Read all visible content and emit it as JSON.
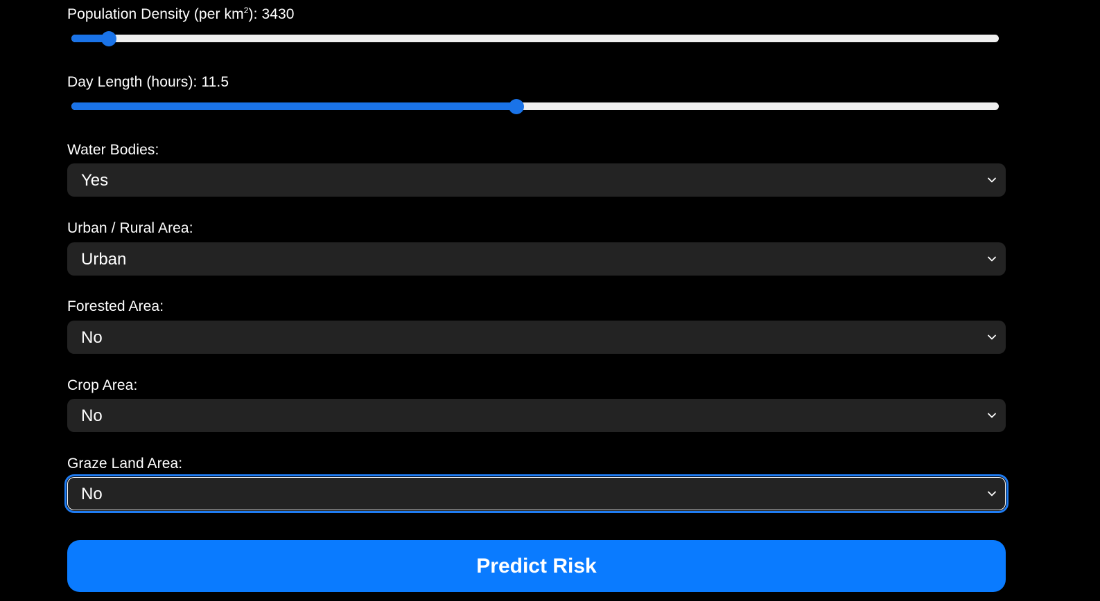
{
  "population_density": {
    "label": "Population Density (per km",
    "sup": "2",
    "label_suffix": "): ",
    "value": "3430",
    "fraction": 0.04
  },
  "day_length": {
    "label": "Day Length (hours): ",
    "value": "11.5",
    "fraction": 0.48
  },
  "water_bodies": {
    "label": "Water Bodies:",
    "value": "Yes"
  },
  "urban_rural": {
    "label": "Urban / Rural Area:",
    "value": "Urban"
  },
  "forested": {
    "label": "Forested Area:",
    "value": "No"
  },
  "crop": {
    "label": "Crop Area:",
    "value": "No"
  },
  "graze_land": {
    "label": "Graze Land Area:",
    "value": "No"
  },
  "predict_button": {
    "label": "Predict Risk"
  },
  "colors": {
    "accent": "#1a73e8",
    "button": "#0a7bff",
    "select_bg": "#232323",
    "background": "#000000"
  },
  "icons": {
    "dropdown": "chevron-down-icon"
  }
}
